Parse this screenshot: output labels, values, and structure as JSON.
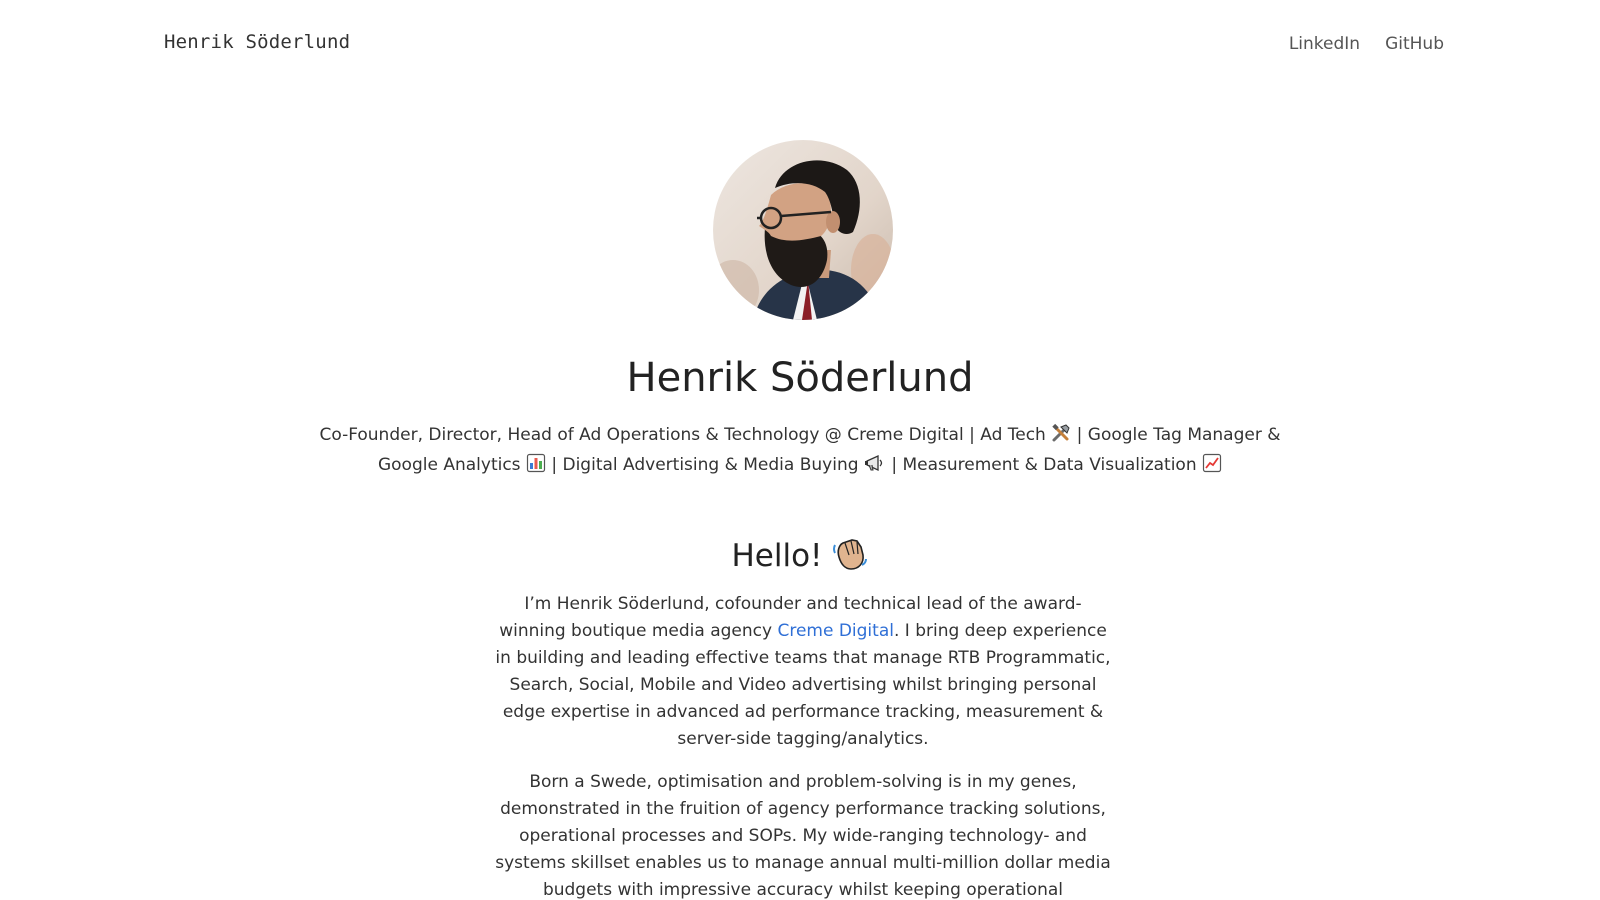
{
  "header": {
    "brand": "Henrik Söderlund",
    "nav": [
      {
        "label": "LinkedIn"
      },
      {
        "label": "GitHub"
      }
    ]
  },
  "profile": {
    "name": "Henrik Söderlund",
    "tagline": {
      "part1": "Co-Founder, Director, Head of Ad Operations & Technology @ Creme Digital | Ad Tech",
      "part2": "| Google Tag Manager & Google Analytics",
      "part3": "| Digital Advertising & Media Buying",
      "part4": "| Measurement & Data Visualization"
    },
    "icons": [
      "tools-icon",
      "bar-chart-icon",
      "megaphone-icon",
      "chart-increasing-icon"
    ]
  },
  "intro": {
    "heading": "Hello!",
    "heading_icon": "waving-hand-icon",
    "paragraph1": {
      "before_link": "I’m Henrik Söderlund, cofounder and technical lead of the award-winning boutique media agency",
      "link_text": "Creme Digital",
      "after_link": ". I bring deep experience in building and leading effective teams that manage RTB Programmatic, Search, Social, Mobile and Video advertising whilst bringing personal edge expertise in advanced ad performance tracking, measurement & server-side tagging/analytics."
    },
    "paragraph2": "Born a Swede, optimisation and problem-solving is in my genes, demonstrated in the fruition of agency performance tracking solutions, operational processes and SOPs. My wide-ranging technology- and systems skillset enables us to manage annual multi-million dollar media budgets with impressive accuracy whilst keeping operational expenditure to a minimum."
  },
  "colors": {
    "link": "#2f6fd6",
    "text": "#333333",
    "heading": "#222222"
  }
}
